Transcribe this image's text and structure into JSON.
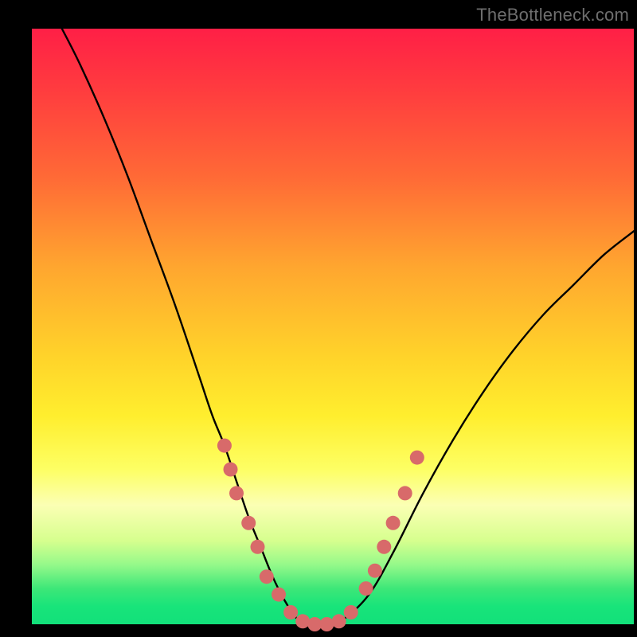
{
  "attribution": "TheBottleneck.com",
  "chart_data": {
    "type": "line",
    "title": "",
    "xlabel": "",
    "ylabel": "",
    "xlim": [
      0,
      100
    ],
    "ylim": [
      0,
      100
    ],
    "series": [
      {
        "name": "bottleneck-curve",
        "x": [
          5,
          8,
          12,
          16,
          20,
          24,
          28,
          30,
          32,
          34,
          36,
          38,
          40,
          42,
          44,
          46,
          48,
          50,
          52,
          56,
          60,
          65,
          70,
          75,
          80,
          85,
          90,
          95,
          100
        ],
        "y": [
          100,
          94,
          85,
          75,
          64,
          53,
          41,
          35,
          30,
          24,
          18,
          13,
          8,
          4,
          1,
          0,
          0,
          0,
          1,
          5,
          12,
          22,
          31,
          39,
          46,
          52,
          57,
          62,
          66
        ]
      }
    ],
    "markers": {
      "name": "scatter-dots",
      "points": [
        {
          "x": 32,
          "y": 30
        },
        {
          "x": 33,
          "y": 26
        },
        {
          "x": 34,
          "y": 22
        },
        {
          "x": 36,
          "y": 17
        },
        {
          "x": 37.5,
          "y": 13
        },
        {
          "x": 39,
          "y": 8
        },
        {
          "x": 41,
          "y": 5
        },
        {
          "x": 43,
          "y": 2
        },
        {
          "x": 45,
          "y": 0.5
        },
        {
          "x": 47,
          "y": 0
        },
        {
          "x": 49,
          "y": 0
        },
        {
          "x": 51,
          "y": 0.5
        },
        {
          "x": 53,
          "y": 2
        },
        {
          "x": 55.5,
          "y": 6
        },
        {
          "x": 57,
          "y": 9
        },
        {
          "x": 58.5,
          "y": 13
        },
        {
          "x": 60,
          "y": 17
        },
        {
          "x": 62,
          "y": 22
        },
        {
          "x": 64,
          "y": 28
        }
      ],
      "color": "#d86a6a",
      "radius_px": 9
    },
    "gradient_stops": [
      {
        "pos": 0,
        "color": "#ff1f46"
      },
      {
        "pos": 55,
        "color": "#ffd32a"
      },
      {
        "pos": 80,
        "color": "#fbffb4"
      },
      {
        "pos": 100,
        "color": "#12e07a"
      }
    ]
  }
}
